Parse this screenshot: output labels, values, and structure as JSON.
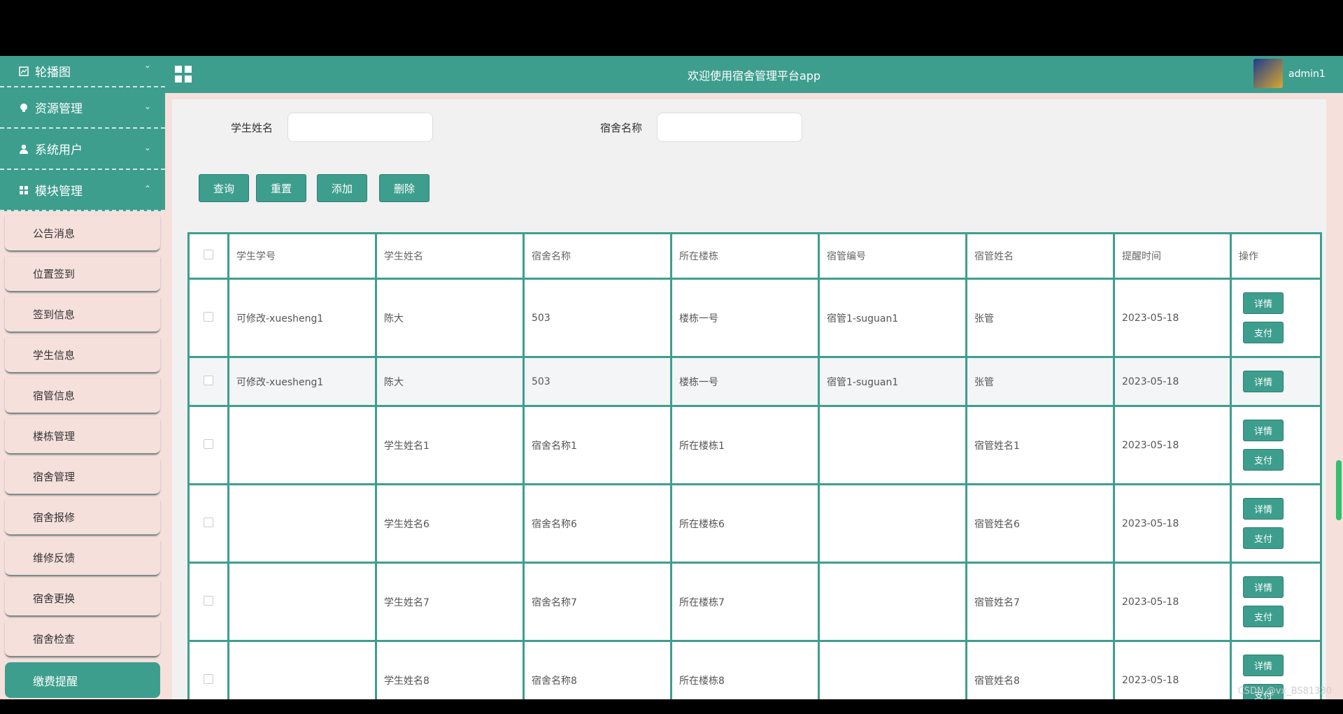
{
  "header": {
    "title": "欢迎使用宿舍管理平台app",
    "username": "admin1"
  },
  "sidebar": {
    "groups": [
      {
        "label": "轮播图"
      },
      {
        "label": "资源管理"
      },
      {
        "label": "系统用户"
      },
      {
        "label": "模块管理"
      }
    ],
    "sub_items": [
      {
        "label": "公告消息"
      },
      {
        "label": "位置签到"
      },
      {
        "label": "签到信息"
      },
      {
        "label": "学生信息"
      },
      {
        "label": "宿管信息"
      },
      {
        "label": "楼栋管理"
      },
      {
        "label": "宿舍管理"
      },
      {
        "label": "宿舍报修"
      },
      {
        "label": "维修反馈"
      },
      {
        "label": "宿舍更换"
      },
      {
        "label": "宿舍检查"
      },
      {
        "label": "缴费提醒"
      }
    ]
  },
  "search": {
    "student_name_label": "学生姓名",
    "student_name_value": "",
    "dorm_name_label": "宿舍名称",
    "dorm_name_value": ""
  },
  "actions": {
    "query": "查询",
    "reset": "重置",
    "add": "添加",
    "delete": "删除"
  },
  "table": {
    "columns": [
      "学生学号",
      "学生姓名",
      "宿舍名称",
      "所在楼栋",
      "宿管编号",
      "宿管姓名",
      "提醒时间",
      "操作"
    ],
    "rows": [
      {
        "student_no": "可修改-xuesheng1",
        "student_name": "陈大",
        "dorm_name": "503",
        "building": "楼栋一号",
        "manager_no": "宿管1-suguan1",
        "manager_name": "张管",
        "time": "2023-05-18"
      },
      {
        "student_no": "可修改-xuesheng1",
        "student_name": "陈大",
        "dorm_name": "503",
        "building": "楼栋一号",
        "manager_no": "宿管1-suguan1",
        "manager_name": "张管",
        "time": "2023-05-18"
      },
      {
        "student_no": "",
        "student_name": "学生姓名1",
        "dorm_name": "宿舍名称1",
        "building": "所在楼栋1",
        "manager_no": "",
        "manager_name": "宿管姓名1",
        "time": "2023-05-18"
      },
      {
        "student_no": "",
        "student_name": "学生姓名6",
        "dorm_name": "宿舍名称6",
        "building": "所在楼栋6",
        "manager_no": "",
        "manager_name": "宿管姓名6",
        "time": "2023-05-18"
      },
      {
        "student_no": "",
        "student_name": "学生姓名7",
        "dorm_name": "宿舍名称7",
        "building": "所在楼栋7",
        "manager_no": "",
        "manager_name": "宿管姓名7",
        "time": "2023-05-18"
      },
      {
        "student_no": "",
        "student_name": "学生姓名8",
        "dorm_name": "宿舍名称8",
        "building": "所在楼栋8",
        "manager_no": "",
        "manager_name": "宿管姓名8",
        "time": "2023-05-18"
      }
    ],
    "detail_label": "详情",
    "pay_label": "支付"
  },
  "watermark": "CSDN @vx_BS81330",
  "colors": {
    "primary": "#3e9e8e",
    "sidebar_bg": "#f5e0dc",
    "content_bg": "#f1f1f1",
    "scroll_thumb": "#31c06c"
  },
  "icons": {
    "group_icons": [
      "image-icon",
      "bulb-icon",
      "user-icon",
      "grid-icon"
    ],
    "collapse": "chevron-icon"
  }
}
